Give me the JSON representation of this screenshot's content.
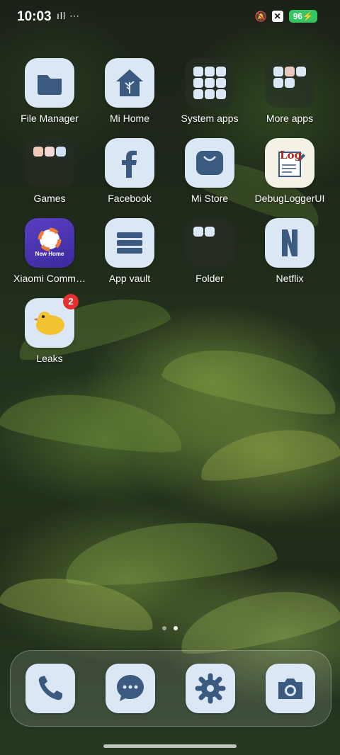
{
  "status_bar": {
    "time": "10:03",
    "left_icons": "ıll ⋯",
    "battery": "96",
    "icons": [
      "vibrate-icon",
      "mute-bell-icon",
      "close-box-icon",
      "battery-charging-icon"
    ]
  },
  "apps": [
    {
      "label": "File Manager",
      "icon": "folder-icon"
    },
    {
      "label": "Mi Home",
      "icon": "home-tree-icon"
    },
    {
      "label": "System apps",
      "icon": "app-folder"
    },
    {
      "label": "More apps",
      "icon": "app-folder"
    },
    {
      "label": "Games",
      "icon": "app-folder"
    },
    {
      "label": "Facebook",
      "icon": "facebook-icon"
    },
    {
      "label": "Mi Store",
      "icon": "shopping-bag-icon"
    },
    {
      "label": "DebugLoggerUI",
      "icon": "log-icon",
      "icon_text": "Log"
    },
    {
      "label": "Xiaomi Comm…",
      "icon": "new-home-icon",
      "icon_text": "New Home"
    },
    {
      "label": "App vault",
      "icon": "vault-icon"
    },
    {
      "label": "Folder",
      "icon": "app-folder"
    },
    {
      "label": "Netflix",
      "icon": "netflix-icon"
    },
    {
      "label": "Leaks",
      "icon": "bird-icon",
      "badge": "2"
    }
  ],
  "page_indicator": {
    "pages": 2,
    "active": 2
  },
  "dock": [
    {
      "icon": "phone-icon"
    },
    {
      "icon": "messages-icon"
    },
    {
      "icon": "settings-icon"
    },
    {
      "icon": "camera-icon"
    }
  ],
  "colors": {
    "tile": "#dbe7f5",
    "glyph": "#3b5a80",
    "badge": "#e53030",
    "battery": "#37c463"
  }
}
